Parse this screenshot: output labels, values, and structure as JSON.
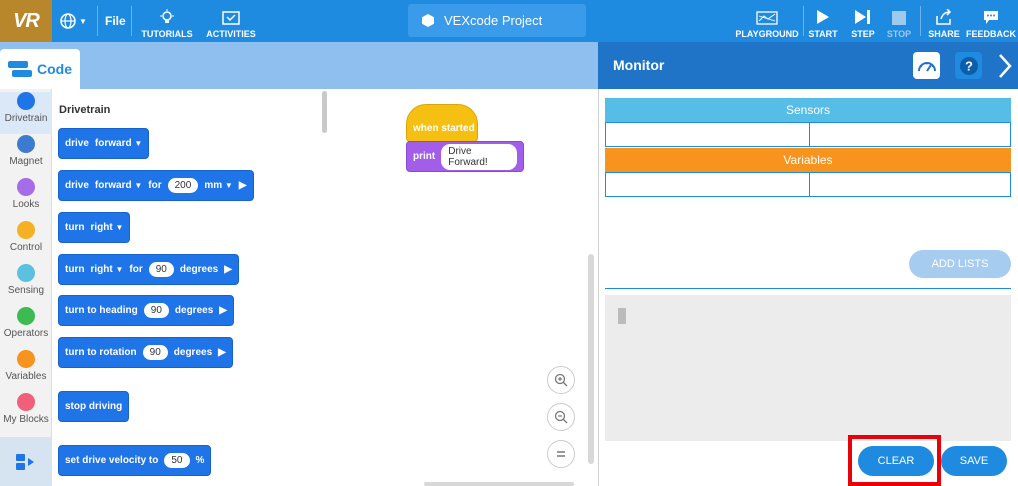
{
  "topbar": {
    "logo": "VR",
    "file_label": "File",
    "tutorials_label": "TUTORIALS",
    "activities_label": "ACTIVITIES",
    "project_title": "VEXcode Project",
    "playground_label": "PLAYGROUND",
    "start_label": "START",
    "step_label": "STEP",
    "stop_label": "STOP",
    "share_label": "SHARE",
    "feedback_label": "FEEDBACK"
  },
  "code_tab": {
    "label": "Code"
  },
  "categories": [
    {
      "label": "Drivetrain",
      "color": "#1f74e8"
    },
    {
      "label": "Magnet",
      "color": "#3d7bd0"
    },
    {
      "label": "Looks",
      "color": "#a66de8"
    },
    {
      "label": "Control",
      "color": "#f5b026"
    },
    {
      "label": "Sensing",
      "color": "#5cc0e0"
    },
    {
      "label": "Operators",
      "color": "#3dbb52"
    },
    {
      "label": "Variables",
      "color": "#f7941e"
    },
    {
      "label": "My Blocks",
      "color": "#f06078"
    }
  ],
  "palette": {
    "title": "Drivetrain",
    "b1": {
      "word": "drive",
      "dir": "forward"
    },
    "b2": {
      "word": "drive",
      "dir": "forward",
      "for": "for",
      "value": "200",
      "unit": "mm"
    },
    "b3": {
      "word": "turn",
      "dir": "right"
    },
    "b4": {
      "word": "turn",
      "dir": "right",
      "for": "for",
      "value": "90",
      "unit": "degrees"
    },
    "b5": {
      "text": "turn to heading",
      "value": "90",
      "unit": "degrees"
    },
    "b6": {
      "text": "turn to rotation",
      "value": "90",
      "unit": "degrees"
    },
    "b7": {
      "text": "stop driving"
    },
    "b8": {
      "text": "set drive velocity to",
      "value": "50",
      "unit": "%"
    }
  },
  "workspace": {
    "hat_label": "when started",
    "print_label": "print",
    "print_value": "Drive Forward!"
  },
  "monitor": {
    "title": "Monitor",
    "sensors_label": "Sensors",
    "variables_label": "Variables",
    "add_lists_label": "ADD LISTS",
    "clear_label": "CLEAR",
    "save_label": "SAVE"
  },
  "colors": {
    "topbar": "#1f8be0",
    "sensors_header": "#55bde6",
    "variables_header": "#f7941e",
    "highlight": "#e8000b"
  }
}
